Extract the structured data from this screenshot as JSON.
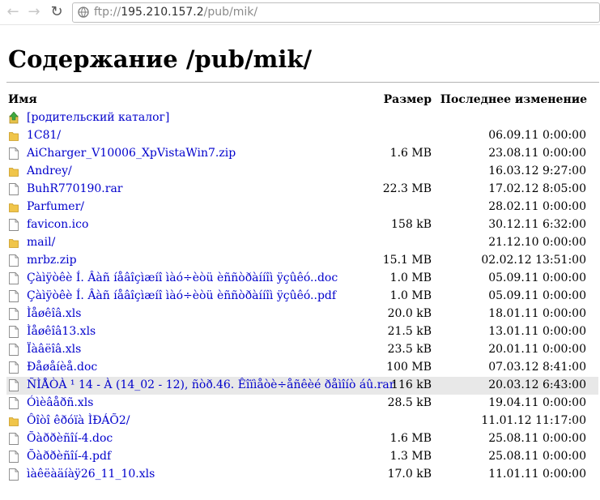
{
  "browser": {
    "url_dim": "ftp://",
    "url_main": "195.210.157.2",
    "url_path": "/pub/mik/"
  },
  "page": {
    "title": "Содержание /pub/mik/",
    "col_name": "Имя",
    "col_size": "Размер",
    "col_date": "Последнее изменение"
  },
  "rows": [
    {
      "icon": "up",
      "name": "[родительский каталог]",
      "size": "",
      "date": ""
    },
    {
      "icon": "folder",
      "name": "1C81/",
      "size": "",
      "date": "06.09.11 0:00:00"
    },
    {
      "icon": "file",
      "name": "AiCharger_V10006_XpVistaWin7.zip",
      "size": "1.6 MB",
      "date": "23.08.11 0:00:00"
    },
    {
      "icon": "folder",
      "name": "Andrey/",
      "size": "",
      "date": "16.03.12 9:27:00"
    },
    {
      "icon": "file",
      "name": "BuhR770190.rar",
      "size": "22.3 MB",
      "date": "17.02.12 8:05:00"
    },
    {
      "icon": "folder",
      "name": "Parfumer/",
      "size": "",
      "date": "28.02.11 0:00:00"
    },
    {
      "icon": "file",
      "name": "favicon.ico",
      "size": "158 kB",
      "date": "30.12.11 6:32:00"
    },
    {
      "icon": "folder",
      "name": "mail/",
      "size": "",
      "date": "21.12.10 0:00:00"
    },
    {
      "icon": "file",
      "name": "mrbz.zip",
      "size": "15.1 MB",
      "date": "02.02.12 13:51:00"
    },
    {
      "icon": "file",
      "name": "Çàìÿòêè Í. Âàñ íåâîçìæíî ìàó÷èòü èññòðàííîì ÿçûêó..doc",
      "size": "1.0 MB",
      "date": "05.09.11 0:00:00"
    },
    {
      "icon": "file",
      "name": "Çàìÿòêè Í. Âàñ íåâîçìæíî ìàó÷èòü èññòðàííîì ÿçûêó..pdf",
      "size": "1.0 MB",
      "date": "05.09.11 0:00:00"
    },
    {
      "icon": "file",
      "name": "Ìåøêîâ.xls",
      "size": "20.0 kB",
      "date": "18.01.11 0:00:00"
    },
    {
      "icon": "file",
      "name": "Ìåøêîâ13.xls",
      "size": "21.5 kB",
      "date": "13.01.11 0:00:00"
    },
    {
      "icon": "file",
      "name": "Ïàâëîâ.xls",
      "size": "23.5 kB",
      "date": "20.01.11 0:00:00"
    },
    {
      "icon": "file",
      "name": "Ðåøåíèå.doc",
      "size": "100 MB",
      "date": "07.03.12 8:41:00"
    },
    {
      "icon": "file",
      "name": "ÑÌÅÒÀ ¹ 14 - À (14_02 - 12), ñòð.46. Êîïìåòè÷åñêèé ðåìîíò áû.rar",
      "size": "116 kB",
      "date": "20.03.12 6:43:00",
      "highlight": true
    },
    {
      "icon": "file",
      "name": "Óìèâåðñ.xls",
      "size": "28.5 kB",
      "date": "19.04.11 0:00:00"
    },
    {
      "icon": "folder",
      "name": "Ôîòî êðóïà ÌÐÁÕ2/",
      "size": "",
      "date": "11.01.12 11:17:00"
    },
    {
      "icon": "file",
      "name": "Õàððèñîí-4.doc",
      "size": "1.6 MB",
      "date": "25.08.11 0:00:00"
    },
    {
      "icon": "file",
      "name": "Õàððèñîí-4.pdf",
      "size": "1.3 MB",
      "date": "25.08.11 0:00:00"
    },
    {
      "icon": "file",
      "name": "ìàêëàäíàÿ26_11_10.xls",
      "size": "17.0 kB",
      "date": "11.01.11 0:00:00"
    }
  ]
}
